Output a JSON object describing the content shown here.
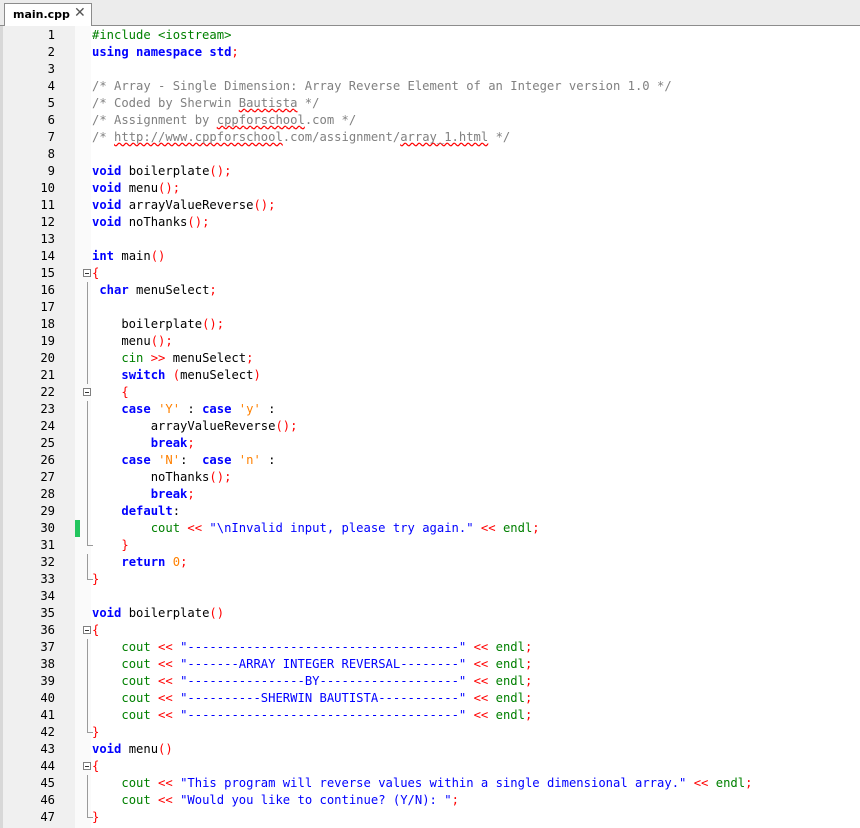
{
  "tab": {
    "label": "main.cpp",
    "close_glyph": "✕",
    "close_icon": "close-icon"
  },
  "colors": {
    "keyword": "#0000ff",
    "preprocessor": "#008000",
    "comment": "#808080",
    "operator": "#ff0000",
    "number": "#ff8000",
    "changed_marker": "#22c55e"
  },
  "lines": [
    {
      "n": "1",
      "t": [
        [
          "pp",
          "#include <iostream>"
        ]
      ]
    },
    {
      "n": "2",
      "t": [
        [
          "kw",
          "using namespace std"
        ],
        [
          "op",
          ";"
        ]
      ]
    },
    {
      "n": "3",
      "t": []
    },
    {
      "n": "4",
      "t": [
        [
          "cm",
          "/* Array - Single Dimension: Array Reverse Element of an Integer version 1.0 */"
        ]
      ]
    },
    {
      "n": "5",
      "t": [
        [
          "cm",
          "/* Coded by Sherwin "
        ],
        [
          "cms",
          "Bautista"
        ],
        [
          "cm",
          " */"
        ]
      ]
    },
    {
      "n": "6",
      "t": [
        [
          "cm",
          "/* Assignment by "
        ],
        [
          "cms",
          "cppforschool"
        ],
        [
          "cm",
          ".com */"
        ]
      ]
    },
    {
      "n": "7",
      "t": [
        [
          "cm",
          "/* "
        ],
        [
          "cms",
          "http://www.cppforschool"
        ],
        [
          "cm",
          ".com/assignment/"
        ],
        [
          "cms",
          "array_1.html"
        ],
        [
          "cm",
          " */"
        ]
      ]
    },
    {
      "n": "8",
      "t": []
    },
    {
      "n": "9",
      "t": [
        [
          "kw",
          "void"
        ],
        [
          "id",
          " boilerplate"
        ],
        [
          "op",
          "();"
        ]
      ]
    },
    {
      "n": "10",
      "t": [
        [
          "kw",
          "void"
        ],
        [
          "id",
          " menu"
        ],
        [
          "op",
          "();"
        ]
      ]
    },
    {
      "n": "11",
      "t": [
        [
          "kw",
          "void"
        ],
        [
          "id",
          " arrayValueReverse"
        ],
        [
          "op",
          "();"
        ]
      ]
    },
    {
      "n": "12",
      "t": [
        [
          "kw",
          "void"
        ],
        [
          "id",
          " noThanks"
        ],
        [
          "op",
          "();"
        ]
      ]
    },
    {
      "n": "13",
      "t": []
    },
    {
      "n": "14",
      "t": [
        [
          "kw",
          "int"
        ],
        [
          "id",
          " main"
        ],
        [
          "op",
          "()"
        ]
      ]
    },
    {
      "n": "15",
      "t": [
        [
          "op",
          "{"
        ]
      ]
    },
    {
      "n": "16",
      "t": [
        [
          "id",
          " "
        ],
        [
          "kw",
          "char"
        ],
        [
          "id",
          " menuSelect"
        ],
        [
          "op",
          ";"
        ]
      ]
    },
    {
      "n": "17",
      "t": []
    },
    {
      "n": "18",
      "t": [
        [
          "id",
          "    boilerplate"
        ],
        [
          "op",
          "();"
        ]
      ]
    },
    {
      "n": "19",
      "t": [
        [
          "id",
          "    menu"
        ],
        [
          "op",
          "();"
        ]
      ]
    },
    {
      "n": "20",
      "t": [
        [
          "id",
          "    "
        ],
        [
          "pp",
          "cin"
        ],
        [
          "op",
          " >>"
        ],
        [
          "id",
          " menuSelect"
        ],
        [
          "op",
          ";"
        ]
      ]
    },
    {
      "n": "21",
      "t": [
        [
          "id",
          "    "
        ],
        [
          "kw",
          "switch"
        ],
        [
          "id",
          " "
        ],
        [
          "op",
          "("
        ],
        [
          "id",
          "menuSelect"
        ],
        [
          "op",
          ")"
        ]
      ]
    },
    {
      "n": "22",
      "t": [
        [
          "id",
          "    "
        ],
        [
          "op",
          "{"
        ]
      ]
    },
    {
      "n": "23",
      "t": [
        [
          "id",
          "    "
        ],
        [
          "kw",
          "case"
        ],
        [
          "id",
          " "
        ],
        [
          "num",
          "'Y'"
        ],
        [
          "id",
          " : "
        ],
        [
          "kw",
          "case"
        ],
        [
          "id",
          " "
        ],
        [
          "num",
          "'y'"
        ],
        [
          "id",
          " :"
        ]
      ]
    },
    {
      "n": "24",
      "t": [
        [
          "id",
          "        arrayValueReverse"
        ],
        [
          "op",
          "();"
        ]
      ]
    },
    {
      "n": "25",
      "t": [
        [
          "id",
          "        "
        ],
        [
          "kw",
          "break"
        ],
        [
          "op",
          ";"
        ]
      ]
    },
    {
      "n": "26",
      "t": [
        [
          "id",
          "    "
        ],
        [
          "kw",
          "case"
        ],
        [
          "id",
          " "
        ],
        [
          "num",
          "'N'"
        ],
        [
          "id",
          ":  "
        ],
        [
          "kw",
          "case"
        ],
        [
          "id",
          " "
        ],
        [
          "num",
          "'n'"
        ],
        [
          "id",
          " :"
        ]
      ]
    },
    {
      "n": "27",
      "t": [
        [
          "id",
          "        noThanks"
        ],
        [
          "op",
          "();"
        ]
      ]
    },
    {
      "n": "28",
      "t": [
        [
          "id",
          "        "
        ],
        [
          "kw",
          "break"
        ],
        [
          "op",
          ";"
        ]
      ]
    },
    {
      "n": "29",
      "t": [
        [
          "id",
          "    "
        ],
        [
          "kw",
          "default"
        ],
        [
          "id",
          ":"
        ]
      ]
    },
    {
      "n": "30",
      "t": [
        [
          "id",
          "        "
        ],
        [
          "pp",
          "cout"
        ],
        [
          "op",
          " <<"
        ],
        [
          "id",
          " "
        ],
        [
          "str",
          "\"\\nInvalid input, please try again.\""
        ],
        [
          "op",
          " <<"
        ],
        [
          "id",
          " "
        ],
        [
          "pp",
          "endl"
        ],
        [
          "op",
          ";"
        ]
      ]
    },
    {
      "n": "31",
      "t": [
        [
          "id",
          "    "
        ],
        [
          "op",
          "}"
        ]
      ]
    },
    {
      "n": "32",
      "t": [
        [
          "id",
          "    "
        ],
        [
          "kw",
          "return"
        ],
        [
          "id",
          " "
        ],
        [
          "num",
          "0"
        ],
        [
          "op",
          ";"
        ]
      ]
    },
    {
      "n": "33",
      "t": [
        [
          "op",
          "}"
        ]
      ]
    },
    {
      "n": "34",
      "t": []
    },
    {
      "n": "35",
      "t": [
        [
          "kw",
          "void"
        ],
        [
          "id",
          " boilerplate"
        ],
        [
          "op",
          "()"
        ]
      ]
    },
    {
      "n": "36",
      "t": [
        [
          "op",
          "{"
        ]
      ]
    },
    {
      "n": "37",
      "t": [
        [
          "id",
          "    "
        ],
        [
          "pp",
          "cout"
        ],
        [
          "op",
          " <<"
        ],
        [
          "id",
          " "
        ],
        [
          "str",
          "\"-------------------------------------\""
        ],
        [
          "op",
          " <<"
        ],
        [
          "id",
          " "
        ],
        [
          "pp",
          "endl"
        ],
        [
          "op",
          ";"
        ]
      ]
    },
    {
      "n": "38",
      "t": [
        [
          "id",
          "    "
        ],
        [
          "pp",
          "cout"
        ],
        [
          "op",
          " <<"
        ],
        [
          "id",
          " "
        ],
        [
          "str",
          "\"-------ARRAY INTEGER REVERSAL--------\""
        ],
        [
          "op",
          " <<"
        ],
        [
          "id",
          " "
        ],
        [
          "pp",
          "endl"
        ],
        [
          "op",
          ";"
        ]
      ]
    },
    {
      "n": "39",
      "t": [
        [
          "id",
          "    "
        ],
        [
          "pp",
          "cout"
        ],
        [
          "op",
          " <<"
        ],
        [
          "id",
          " "
        ],
        [
          "str",
          "\"----------------BY-------------------\""
        ],
        [
          "op",
          " <<"
        ],
        [
          "id",
          " "
        ],
        [
          "pp",
          "endl"
        ],
        [
          "op",
          ";"
        ]
      ]
    },
    {
      "n": "40",
      "t": [
        [
          "id",
          "    "
        ],
        [
          "pp",
          "cout"
        ],
        [
          "op",
          " <<"
        ],
        [
          "id",
          " "
        ],
        [
          "str",
          "\"----------SHERWIN BAUTISTA-----------\""
        ],
        [
          "op",
          " <<"
        ],
        [
          "id",
          " "
        ],
        [
          "pp",
          "endl"
        ],
        [
          "op",
          ";"
        ]
      ]
    },
    {
      "n": "41",
      "t": [
        [
          "id",
          "    "
        ],
        [
          "pp",
          "cout"
        ],
        [
          "op",
          " <<"
        ],
        [
          "id",
          " "
        ],
        [
          "str",
          "\"-------------------------------------\""
        ],
        [
          "op",
          " <<"
        ],
        [
          "id",
          " "
        ],
        [
          "pp",
          "endl"
        ],
        [
          "op",
          ";"
        ]
      ]
    },
    {
      "n": "42",
      "t": [
        [
          "op",
          "}"
        ]
      ]
    },
    {
      "n": "43",
      "t": [
        [
          "kw",
          "void"
        ],
        [
          "id",
          " menu"
        ],
        [
          "op",
          "()"
        ]
      ]
    },
    {
      "n": "44",
      "t": [
        [
          "op",
          "{"
        ]
      ]
    },
    {
      "n": "45",
      "t": [
        [
          "id",
          "    "
        ],
        [
          "pp",
          "cout"
        ],
        [
          "op",
          " <<"
        ],
        [
          "id",
          " "
        ],
        [
          "str",
          "\"This program will reverse values within a single dimensional array.\""
        ],
        [
          "op",
          " <<"
        ],
        [
          "id",
          " "
        ],
        [
          "pp",
          "endl"
        ],
        [
          "op",
          ";"
        ]
      ]
    },
    {
      "n": "46",
      "t": [
        [
          "id",
          "    "
        ],
        [
          "pp",
          "cout"
        ],
        [
          "op",
          " <<"
        ],
        [
          "id",
          " "
        ],
        [
          "str",
          "\"Would you like to continue? (Y/N): \""
        ],
        [
          "op",
          ";"
        ]
      ]
    },
    {
      "n": "47",
      "t": [
        [
          "op",
          "}"
        ]
      ]
    }
  ]
}
